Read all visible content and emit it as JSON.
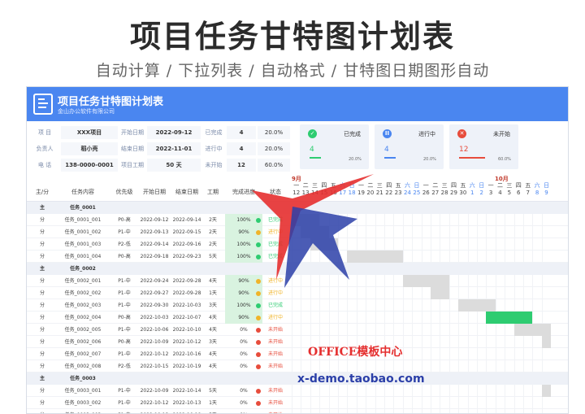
{
  "hero": {
    "title": "项目任务甘特图计划表",
    "subtitle": "自动计算 / 下拉列表 / 自动格式 / 甘特图日期图形自动"
  },
  "sheet": {
    "title": "项目任务甘特图计划表",
    "company": "金山办公软件有限公司"
  },
  "info": [
    {
      "l1": "项 目",
      "v1": "XXX项目",
      "l2": "开始日期",
      "v2": "2022-09-12",
      "l3": "已完成",
      "v3": "4",
      "p3": "20.0%"
    },
    {
      "l1": "负责人",
      "v1": "稻小壳",
      "l2": "结束日期",
      "v2": "2022-11-01",
      "l3": "进行中",
      "v3": "4",
      "p3": "20.0%"
    },
    {
      "l1": "电 话",
      "v1": "138-0000-0001",
      "l2": "项目工期",
      "v2": "50 天",
      "l3": "未开始",
      "v3": "12",
      "p3": "60.0%"
    }
  ],
  "cards": [
    {
      "label": "已完成",
      "num": "4",
      "pct": "20.0%",
      "color": "#2ecc71",
      "icon": "check-icon",
      "glyph": "✓"
    },
    {
      "label": "进行中",
      "num": "4",
      "pct": "20.0%",
      "color": "#4a86f0",
      "icon": "pause-icon",
      "glyph": "II"
    },
    {
      "label": "未开始",
      "num": "12",
      "pct": "60.0%",
      "color": "#e74c3c",
      "icon": "cross-icon",
      "glyph": "✕"
    }
  ],
  "months": {
    "sep": "9月",
    "oct": "10月"
  },
  "headers": [
    "主/分",
    "任务内容",
    "优先级",
    "开始日期",
    "结束日期",
    "工期",
    "完成进度",
    "状态"
  ],
  "weekdays": [
    "一",
    "二",
    "三",
    "四",
    "五",
    "六",
    "日",
    "一",
    "二",
    "三",
    "四",
    "五",
    "六",
    "日",
    "一",
    "二",
    "三",
    "四",
    "五",
    "六",
    "日",
    "一",
    "二",
    "三",
    "四",
    "五",
    "六",
    "日"
  ],
  "days": [
    "12",
    "13",
    "14",
    "15",
    "16",
    "17",
    "18",
    "19",
    "20",
    "21",
    "22",
    "23",
    "24",
    "25",
    "26",
    "27",
    "28",
    "29",
    "30",
    "1",
    "2",
    "3",
    "4",
    "5",
    "6",
    "7",
    "8",
    "9"
  ],
  "groups": [
    {
      "type": "主",
      "name": "任务_0001"
    },
    {
      "type": "主",
      "name": "任务_0002"
    },
    {
      "type": "主",
      "name": "任务_0003"
    }
  ],
  "rows": [
    {
      "type": "分",
      "task": "任务_0001_001",
      "pri": "P0-高",
      "start": "2022-09-12",
      "end": "2022-09-14",
      "dur": "2天",
      "prog": "100%",
      "status": "已完成"
    },
    {
      "type": "分",
      "task": "任务_0001_002",
      "pri": "P1-中",
      "start": "2022-09-13",
      "end": "2022-09-15",
      "dur": "2天",
      "prog": "90%",
      "status": "进行中"
    },
    {
      "type": "分",
      "task": "任务_0001_003",
      "pri": "P2-低",
      "start": "2022-09-14",
      "end": "2022-09-16",
      "dur": "2天",
      "prog": "100%",
      "status": "已完成"
    },
    {
      "type": "分",
      "task": "任务_0001_004",
      "pri": "P0-高",
      "start": "2022-09-18",
      "end": "2022-09-23",
      "dur": "5天",
      "prog": "100%",
      "status": "已完成"
    },
    {
      "type": "分",
      "task": "任务_0002_001",
      "pri": "P1-中",
      "start": "2022-09-24",
      "end": "2022-09-28",
      "dur": "4天",
      "prog": "90%",
      "status": "进行中"
    },
    {
      "type": "分",
      "task": "任务_0002_002",
      "pri": "P1-中",
      "start": "2022-09-27",
      "end": "2022-09-28",
      "dur": "1天",
      "prog": "90%",
      "status": "进行中"
    },
    {
      "type": "分",
      "task": "任务_0002_003",
      "pri": "P1-中",
      "start": "2022-09-30",
      "end": "2022-10-03",
      "dur": "3天",
      "prog": "100%",
      "status": "已完成"
    },
    {
      "type": "分",
      "task": "任务_0002_004",
      "pri": "P0-高",
      "start": "2022-10-03",
      "end": "2022-10-07",
      "dur": "4天",
      "prog": "90%",
      "status": "进行中"
    },
    {
      "type": "分",
      "task": "任务_0002_005",
      "pri": "P1-中",
      "start": "2022-10-06",
      "end": "2022-10-10",
      "dur": "4天",
      "prog": "0%",
      "status": "未开始"
    },
    {
      "type": "分",
      "task": "任务_0002_006",
      "pri": "P0-高",
      "start": "2022-10-09",
      "end": "2022-10-12",
      "dur": "3天",
      "prog": "0%",
      "status": "未开始"
    },
    {
      "type": "分",
      "task": "任务_0002_007",
      "pri": "P1-中",
      "start": "2022-10-12",
      "end": "2022-10-16",
      "dur": "4天",
      "prog": "0%",
      "status": "未开始"
    },
    {
      "type": "分",
      "task": "任务_0002_008",
      "pri": "P2-低",
      "start": "2022-10-15",
      "end": "2022-10-19",
      "dur": "4天",
      "prog": "0%",
      "status": "未开始"
    },
    {
      "type": "分",
      "task": "任务_0003_001",
      "pri": "P1-中",
      "start": "2022-10-09",
      "end": "2022-10-14",
      "dur": "5天",
      "prog": "0%",
      "status": "未开始"
    },
    {
      "type": "分",
      "task": "任务_0003_002",
      "pri": "P1-中",
      "start": "2022-10-12",
      "end": "2022-10-13",
      "dur": "1天",
      "prog": "0%",
      "status": "未开始"
    },
    {
      "type": "分",
      "task": "任务_0003_003",
      "pri": "P1-中",
      "start": "2022-10-13",
      "end": "2022-10-18",
      "dur": "5天",
      "prog": "0%",
      "status": "未开始"
    }
  ],
  "status_colors": {
    "已完成": "#2ecc71",
    "进行中": "#f0b429",
    "未开始": "#e74c3c"
  },
  "watermark": {
    "line1": "OFFICE模板中心",
    "line2": "x-demo.taobao.com"
  }
}
